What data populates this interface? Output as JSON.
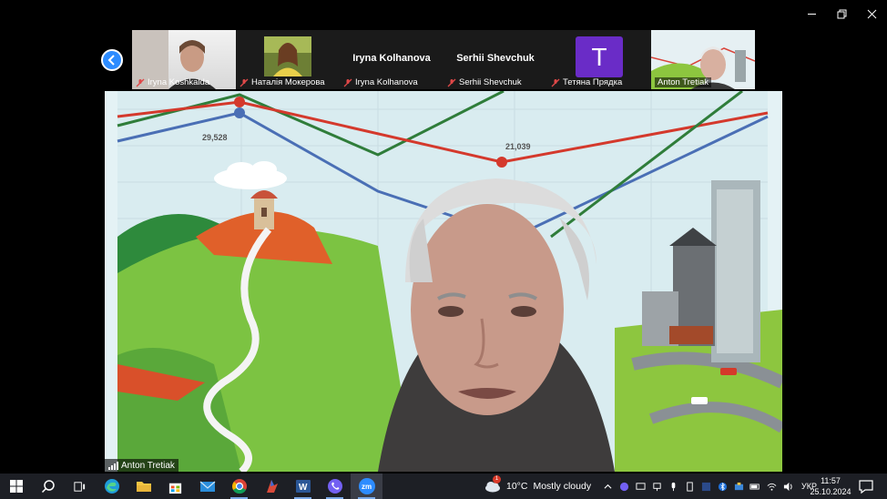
{
  "window": {
    "controls": [
      "minimize-icon",
      "restore-icon",
      "close-icon"
    ]
  },
  "participants": [
    {
      "name": "Iryna Koshkalda",
      "type": "video",
      "muted": true
    },
    {
      "name": "Наталія Мокерова",
      "type": "photo",
      "muted": true
    },
    {
      "name": "Iryna Kolhanova",
      "display_name": "Iryna Kolhanova",
      "type": "name",
      "muted": true
    },
    {
      "name": "Serhii Shevchuk",
      "display_name": "Serhii Shevchuk",
      "type": "name",
      "muted": true
    },
    {
      "name": "Тетяна Прядка",
      "avatar_letter": "T",
      "type": "avatar",
      "avatar_color": "#6a2cc7",
      "muted": true
    },
    {
      "name": "Anton Tretiak",
      "type": "video",
      "muted": false,
      "active": true
    }
  ],
  "main_video": {
    "speaker": "Anton Tretiak",
    "background_labels": {
      "left_value": "29,528",
      "mid_value": "21,039"
    }
  },
  "taskbar": {
    "apps": [
      "windows-start-icon",
      "search-icon",
      "task-view-icon",
      "edge-icon",
      "file-explorer-icon",
      "store-icon",
      "mail-icon",
      "chrome-icon",
      "app-icon",
      "word-icon",
      "viber-icon",
      "zoom-icon"
    ],
    "zoom_label": "zm",
    "weather": {
      "temp": "10°C",
      "condition": "Mostly cloudy",
      "badge": "1"
    },
    "language": "УКР",
    "time": "11:57",
    "date": "25.10.2024"
  },
  "colors": {
    "zoom_blue": "#2d8cff",
    "taskbar": "#1d1f25"
  }
}
